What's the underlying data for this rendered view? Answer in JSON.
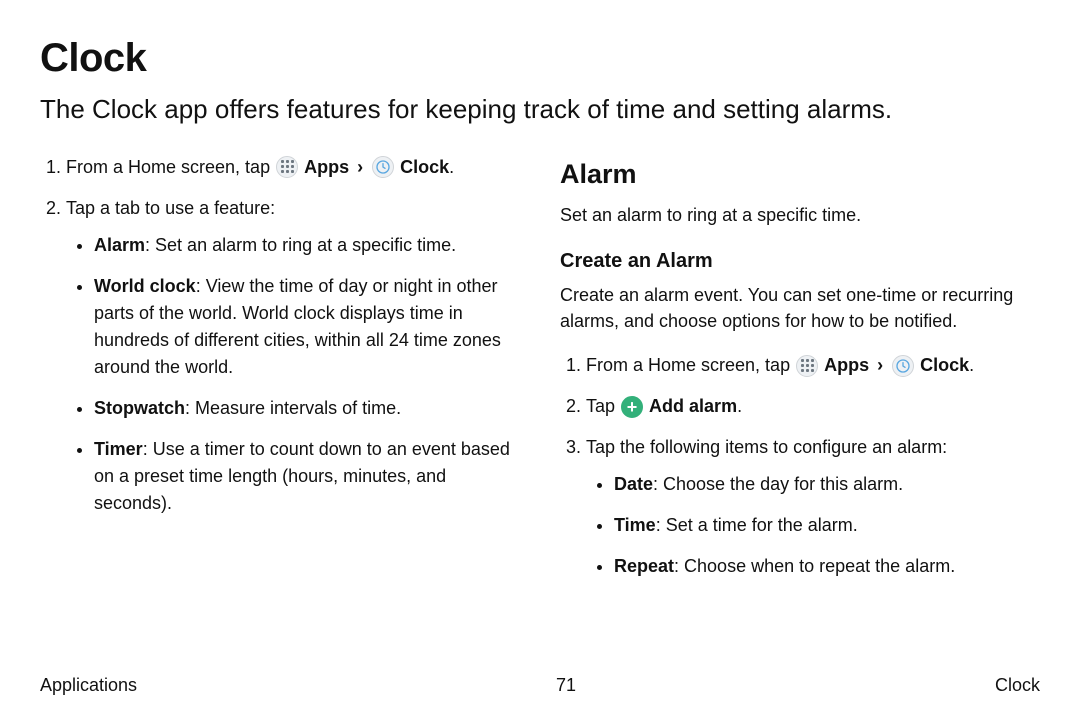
{
  "title": "Clock",
  "intro": "The Clock app offers features for keeping track of time and setting alarms.",
  "nav": {
    "apps_label": "Apps",
    "clock_label": "Clock",
    "add_alarm_label": "Add alarm",
    "chevron": "›"
  },
  "left": {
    "step1_pre": "From a Home screen, tap ",
    "step1_post": ".",
    "step2": "Tap a tab to use a feature:",
    "features": [
      {
        "name": "Alarm",
        "desc": ": Set an alarm to ring at a specific time."
      },
      {
        "name": "World clock",
        "desc": ": View the time of day or night in other parts of the world. World clock displays time in hundreds of different cities, within all 24 time zones around the world."
      },
      {
        "name": "Stopwatch",
        "desc": ": Measure intervals of time."
      },
      {
        "name": "Timer",
        "desc": ": Use a timer to count down to an event based on a preset time length (hours, minutes, and seconds)."
      }
    ]
  },
  "right": {
    "heading": "Alarm",
    "desc": "Set an alarm to ring at a specific time.",
    "sub_heading": "Create an Alarm",
    "sub_desc": "Create an alarm event. You can set one-time or recurring alarms, and choose options for how to be notified.",
    "step1_pre": "From a Home screen, tap ",
    "step1_post": ".",
    "step2_pre": "Tap ",
    "step2_post": ".",
    "step3": "Tap the following items to configure an alarm:",
    "config": [
      {
        "name": "Date",
        "desc": ": Choose the day for this alarm."
      },
      {
        "name": "Time",
        "desc": ": Set a time for the alarm."
      },
      {
        "name": "Repeat",
        "desc": ": Choose when to repeat the alarm."
      }
    ]
  },
  "footer": {
    "left": "Applications",
    "center": "71",
    "right": "Clock"
  }
}
